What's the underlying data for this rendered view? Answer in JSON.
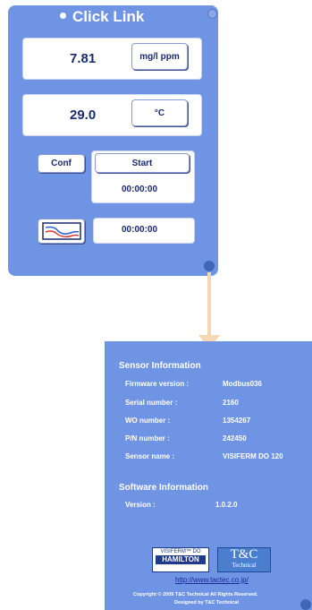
{
  "top_panel": {
    "title": "Click Link",
    "measure1": {
      "value": "7.81",
      "unit_button": "mg/l ppm"
    },
    "measure2": {
      "value": "29.0",
      "unit_button": "°C"
    },
    "conf_button": "Conf",
    "start_button": "Start",
    "timer1": "00:00:00",
    "timer2": "00:00:00"
  },
  "sensor_info": {
    "title": "Sensor Information",
    "rows": [
      {
        "label": "Firmware version :",
        "value": "Modbus036"
      },
      {
        "label": "Serial number  :",
        "value": "2160"
      },
      {
        "label": "WO number  :",
        "value": "1354267"
      },
      {
        "label": "P/N number  :",
        "value": "242450"
      },
      {
        "label": "Sensor name  :",
        "value": "VISIFERM DO 120"
      }
    ]
  },
  "software_info": {
    "title": "Software Information",
    "version_label": "Version :",
    "version_value": "1.0.2.0"
  },
  "logos": {
    "hamilton_top": "VISIFERM™ DO",
    "hamilton_main": "HAMILTON",
    "tc_main": "T&C",
    "tc_sub": "Technical"
  },
  "footer": {
    "url": "http://www.tactec.co.jp/",
    "copyright": "Copyright © 2009 T&C Technical All Rights Reserved.",
    "designed": "Designed by T&C Technical"
  },
  "colors": {
    "panel": "#6f94e3",
    "text_dark": "#1a2a70"
  }
}
